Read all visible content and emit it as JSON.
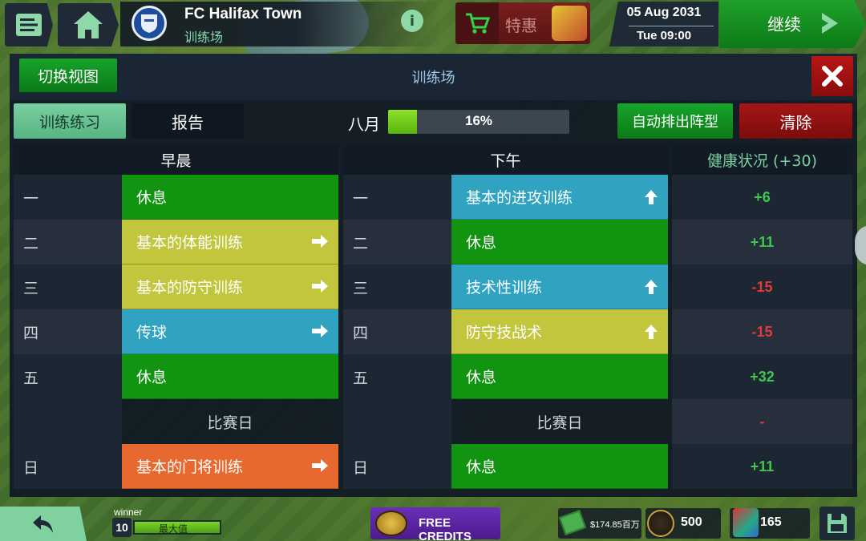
{
  "topbar": {
    "club_name": "FC Halifax Town",
    "club_sub": "训练场",
    "info_icon": "i",
    "deal_label": "特惠",
    "date": "05 Aug 2031",
    "time": "Tue 09:00",
    "continue_label": "继续"
  },
  "panel": {
    "switch_view": "切换视图",
    "title": "训练场",
    "tab_training": "训练练习",
    "tab_report": "报告",
    "month": "八月",
    "progress_text": "16%",
    "progress_value": 16,
    "auto_lineup": "自动排出阵型",
    "clear": "清除"
  },
  "columns": {
    "morning": "早晨",
    "afternoon": "下午",
    "health": "健康状况 (+30)"
  },
  "days": [
    "一",
    "二",
    "三",
    "四",
    "五",
    "日"
  ],
  "matchday": "比赛日",
  "morning": [
    {
      "label": "休息",
      "color": "#11940f",
      "arrow": ""
    },
    {
      "label": "基本的体能训练",
      "color": "#c2c63c",
      "arrow": "right"
    },
    {
      "label": "基本的防守训练",
      "color": "#c2c63c",
      "arrow": "right"
    },
    {
      "label": "传球",
      "color": "#2fa3c0",
      "arrow": "right"
    },
    {
      "label": "休息",
      "color": "#11940f",
      "arrow": ""
    },
    {
      "label": "基本的门将训练",
      "color": "#e8692f",
      "arrow": "right"
    }
  ],
  "afternoon": [
    {
      "label": "基本的进攻训练",
      "color": "#2fa3c0",
      "arrow": "up"
    },
    {
      "label": "休息",
      "color": "#11940f",
      "arrow": ""
    },
    {
      "label": "技术性训练",
      "color": "#2fa3c0",
      "arrow": "up"
    },
    {
      "label": "防守技战术",
      "color": "#c2c63c",
      "arrow": "up"
    },
    {
      "label": "休息",
      "color": "#11940f",
      "arrow": ""
    },
    {
      "label": "休息",
      "color": "#11940f",
      "arrow": ""
    }
  ],
  "health": [
    {
      "value": "+6",
      "color": "#3ec94a"
    },
    {
      "value": "+11",
      "color": "#3ec94a"
    },
    {
      "value": "-15",
      "color": "#e03a3a"
    },
    {
      "value": "-15",
      "color": "#e03a3a"
    },
    {
      "value": "+32",
      "color": "#3ec94a"
    },
    {
      "value": "-",
      "color": "#e03a3a"
    },
    {
      "value": "+11",
      "color": "#3ec94a"
    }
  ],
  "bottombar": {
    "manager_name": "winner",
    "level": "10",
    "xp_label": "最大值",
    "free_credits": "FREE CREDITS",
    "money": "$174.85百万",
    "coins": "500",
    "tokens": "165"
  },
  "icons": {
    "menu": "menu-icon",
    "home": "home-icon",
    "cart": "cart-icon",
    "close": "close-icon",
    "back": "back-arrow-icon",
    "save": "save-icon"
  }
}
